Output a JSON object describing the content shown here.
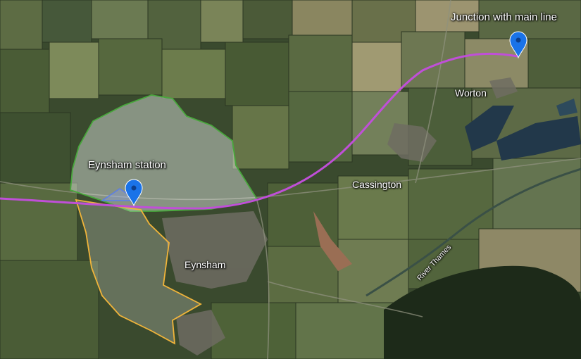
{
  "map": {
    "labels": {
      "eynsham_station": "Eynsham station",
      "junction": "Junction with main line",
      "worton": "Worton",
      "cassington": "Cassington",
      "eynsham": "Eynsham",
      "river": "River Thames"
    },
    "markers": [
      {
        "name": "Eynsham station",
        "color": "#1a73e8"
      },
      {
        "name": "Junction with main line",
        "color": "#1a73e8"
      }
    ],
    "route": {
      "color": "#c04fd8"
    },
    "areas": [
      {
        "name": "Eynsham station",
        "border": "#48a83c",
        "fill": "rgba(230,238,232,0.45)"
      },
      {
        "name": "Eynsham",
        "border": "#f0b43a",
        "fill": "rgba(255,255,255,0.22)"
      }
    ],
    "water_color": "#22384a",
    "woodland_color": "#1d2a19"
  }
}
